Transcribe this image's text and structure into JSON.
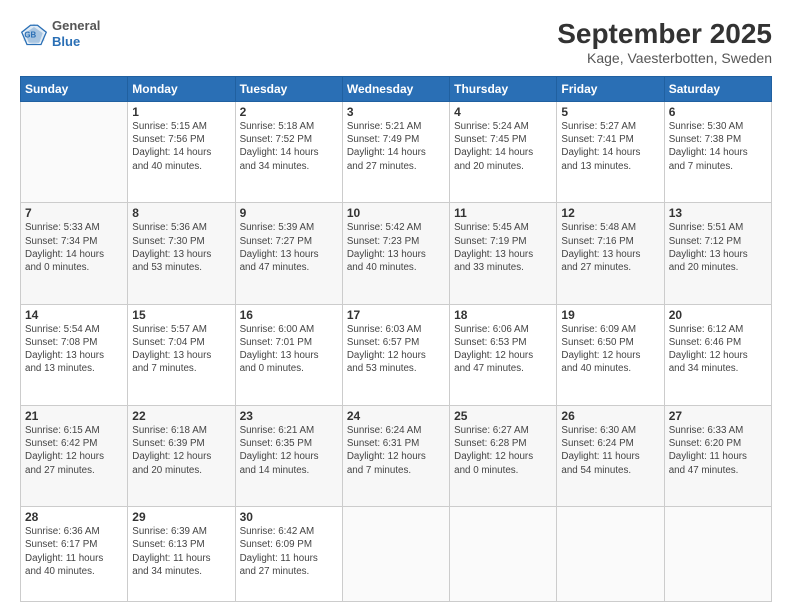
{
  "header": {
    "logo_line1": "General",
    "logo_line2": "Blue",
    "month_year": "September 2025",
    "location": "Kage, Vaesterbotten, Sweden"
  },
  "days": [
    "Sunday",
    "Monday",
    "Tuesday",
    "Wednesday",
    "Thursday",
    "Friday",
    "Saturday"
  ],
  "weeks": [
    [
      {
        "num": "",
        "info": ""
      },
      {
        "num": "1",
        "info": "Sunrise: 5:15 AM\nSunset: 7:56 PM\nDaylight: 14 hours\nand 40 minutes."
      },
      {
        "num": "2",
        "info": "Sunrise: 5:18 AM\nSunset: 7:52 PM\nDaylight: 14 hours\nand 34 minutes."
      },
      {
        "num": "3",
        "info": "Sunrise: 5:21 AM\nSunset: 7:49 PM\nDaylight: 14 hours\nand 27 minutes."
      },
      {
        "num": "4",
        "info": "Sunrise: 5:24 AM\nSunset: 7:45 PM\nDaylight: 14 hours\nand 20 minutes."
      },
      {
        "num": "5",
        "info": "Sunrise: 5:27 AM\nSunset: 7:41 PM\nDaylight: 14 hours\nand 13 minutes."
      },
      {
        "num": "6",
        "info": "Sunrise: 5:30 AM\nSunset: 7:38 PM\nDaylight: 14 hours\nand 7 minutes."
      }
    ],
    [
      {
        "num": "7",
        "info": "Sunrise: 5:33 AM\nSunset: 7:34 PM\nDaylight: 14 hours\nand 0 minutes."
      },
      {
        "num": "8",
        "info": "Sunrise: 5:36 AM\nSunset: 7:30 PM\nDaylight: 13 hours\nand 53 minutes."
      },
      {
        "num": "9",
        "info": "Sunrise: 5:39 AM\nSunset: 7:27 PM\nDaylight: 13 hours\nand 47 minutes."
      },
      {
        "num": "10",
        "info": "Sunrise: 5:42 AM\nSunset: 7:23 PM\nDaylight: 13 hours\nand 40 minutes."
      },
      {
        "num": "11",
        "info": "Sunrise: 5:45 AM\nSunset: 7:19 PM\nDaylight: 13 hours\nand 33 minutes."
      },
      {
        "num": "12",
        "info": "Sunrise: 5:48 AM\nSunset: 7:16 PM\nDaylight: 13 hours\nand 27 minutes."
      },
      {
        "num": "13",
        "info": "Sunrise: 5:51 AM\nSunset: 7:12 PM\nDaylight: 13 hours\nand 20 minutes."
      }
    ],
    [
      {
        "num": "14",
        "info": "Sunrise: 5:54 AM\nSunset: 7:08 PM\nDaylight: 13 hours\nand 13 minutes."
      },
      {
        "num": "15",
        "info": "Sunrise: 5:57 AM\nSunset: 7:04 PM\nDaylight: 13 hours\nand 7 minutes."
      },
      {
        "num": "16",
        "info": "Sunrise: 6:00 AM\nSunset: 7:01 PM\nDaylight: 13 hours\nand 0 minutes."
      },
      {
        "num": "17",
        "info": "Sunrise: 6:03 AM\nSunset: 6:57 PM\nDaylight: 12 hours\nand 53 minutes."
      },
      {
        "num": "18",
        "info": "Sunrise: 6:06 AM\nSunset: 6:53 PM\nDaylight: 12 hours\nand 47 minutes."
      },
      {
        "num": "19",
        "info": "Sunrise: 6:09 AM\nSunset: 6:50 PM\nDaylight: 12 hours\nand 40 minutes."
      },
      {
        "num": "20",
        "info": "Sunrise: 6:12 AM\nSunset: 6:46 PM\nDaylight: 12 hours\nand 34 minutes."
      }
    ],
    [
      {
        "num": "21",
        "info": "Sunrise: 6:15 AM\nSunset: 6:42 PM\nDaylight: 12 hours\nand 27 minutes."
      },
      {
        "num": "22",
        "info": "Sunrise: 6:18 AM\nSunset: 6:39 PM\nDaylight: 12 hours\nand 20 minutes."
      },
      {
        "num": "23",
        "info": "Sunrise: 6:21 AM\nSunset: 6:35 PM\nDaylight: 12 hours\nand 14 minutes."
      },
      {
        "num": "24",
        "info": "Sunrise: 6:24 AM\nSunset: 6:31 PM\nDaylight: 12 hours\nand 7 minutes."
      },
      {
        "num": "25",
        "info": "Sunrise: 6:27 AM\nSunset: 6:28 PM\nDaylight: 12 hours\nand 0 minutes."
      },
      {
        "num": "26",
        "info": "Sunrise: 6:30 AM\nSunset: 6:24 PM\nDaylight: 11 hours\nand 54 minutes."
      },
      {
        "num": "27",
        "info": "Sunrise: 6:33 AM\nSunset: 6:20 PM\nDaylight: 11 hours\nand 47 minutes."
      }
    ],
    [
      {
        "num": "28",
        "info": "Sunrise: 6:36 AM\nSunset: 6:17 PM\nDaylight: 11 hours\nand 40 minutes."
      },
      {
        "num": "29",
        "info": "Sunrise: 6:39 AM\nSunset: 6:13 PM\nDaylight: 11 hours\nand 34 minutes."
      },
      {
        "num": "30",
        "info": "Sunrise: 6:42 AM\nSunset: 6:09 PM\nDaylight: 11 hours\nand 27 minutes."
      },
      {
        "num": "",
        "info": ""
      },
      {
        "num": "",
        "info": ""
      },
      {
        "num": "",
        "info": ""
      },
      {
        "num": "",
        "info": ""
      }
    ]
  ]
}
